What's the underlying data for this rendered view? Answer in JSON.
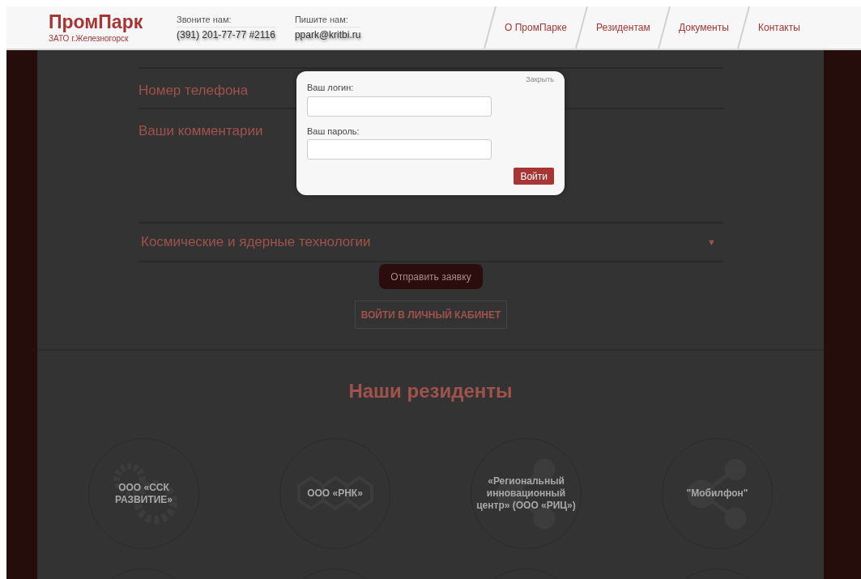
{
  "header": {
    "logo": "ПромПарк",
    "subtitle": "ЗАТО г.Железногорск",
    "contacts": [
      {
        "label": "Звоните нам:",
        "value": "(391) 201-77-77 #2116"
      },
      {
        "label": "Пишите нам:",
        "value": "ppark@kritbi.ru"
      }
    ],
    "nav": [
      {
        "label": "О ПромПарке"
      },
      {
        "label": "Резидентам"
      },
      {
        "label": "Документы"
      },
      {
        "label": "Контакты"
      }
    ]
  },
  "form": {
    "fields": [
      {
        "label": "Номер телефона",
        "kind": "line"
      },
      {
        "label": "Ваши комментарии",
        "kind": "area"
      }
    ],
    "select": {
      "value": "Космические и ядерные технологии",
      "arrow": "▼"
    },
    "submit": "Отправить заявку",
    "cabinet": "ВОЙТИ В ЛИЧНЫЙ КАБИНЕТ"
  },
  "residents": {
    "title": "Наши резиденты",
    "items": [
      {
        "name": "ООО «ССК РАЗВИТИЕ»",
        "kind": "gears"
      },
      {
        "name": "ООО «РНК»",
        "kind": "hexagons"
      },
      {
        "name": "«Региональный инновационный центр» (ООО «РИЦ»)",
        "kind": "network"
      },
      {
        "name": "\"Мобилфон\"",
        "kind": "share"
      }
    ]
  },
  "modal": {
    "close": "Закрыть",
    "fields": [
      {
        "label": "Ваш логин:"
      },
      {
        "label": "Ваш пароль:"
      }
    ],
    "submit": "Войти"
  }
}
